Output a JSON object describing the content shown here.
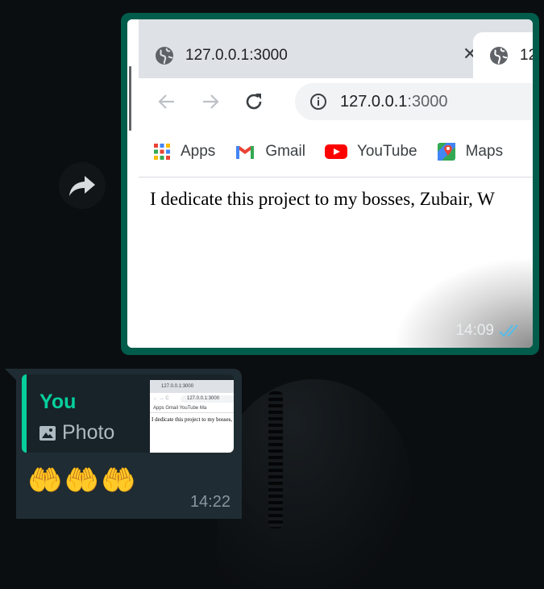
{
  "background": "#0b0e10",
  "colors": {
    "accent": "#06cf9c",
    "outgoing_bubble": "#005c4b",
    "incoming_bubble": "#1f2c33",
    "read_ticks": "#53bdeb"
  },
  "forward_button": {
    "icon": "forward-icon"
  },
  "image_message": {
    "screenshot": {
      "tabs": [
        {
          "title": "127.0.0.1:3000",
          "icon": "globe-icon",
          "active": false
        },
        {
          "title": "12",
          "icon": "globe-icon",
          "active": true
        }
      ],
      "address": {
        "host": "127.0.0.1",
        "port": ":3000"
      },
      "bookmarks": [
        {
          "label": "Apps",
          "icon": "apps-grid-icon"
        },
        {
          "label": "Gmail",
          "icon": "gmail-icon"
        },
        {
          "label": "YouTube",
          "icon": "youtube-icon"
        },
        {
          "label": "Maps",
          "icon": "maps-icon"
        }
      ],
      "page_text": "I dedicate this project to my bosses, Zubair, W"
    },
    "time": "14:09",
    "status": "read"
  },
  "reply_message": {
    "quote": {
      "author": "You",
      "type_label": "Photo",
      "type_icon": "photo-icon",
      "thumb": {
        "tab": "127.0.0.1:3000",
        "address": "127.0.0.1:3000",
        "bookmarks": "Apps  Gmail  YouTube  Ma",
        "page_text": "I dedicate this project to my bosses, Zubair"
      }
    },
    "text": "🤲🤲🤲",
    "time": "14:22"
  }
}
